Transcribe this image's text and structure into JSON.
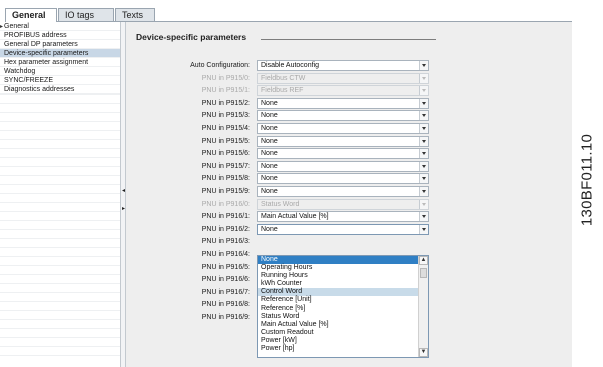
{
  "tabs": [
    "General",
    "IO tags",
    "Texts"
  ],
  "nav": {
    "root": "General",
    "items": [
      "PROFIBUS address",
      "General DP parameters",
      "Device-specific parameters",
      "Hex parameter assignment",
      "Watchdog",
      "SYNC/FREEZE",
      "Diagnostics addresses"
    ],
    "selected_index": 2
  },
  "section_title": "Device-specific parameters",
  "params": [
    {
      "label": "Auto Configuration:",
      "value": "Disable Autoconfig",
      "disabled": false
    },
    {
      "label": "PNU in P915/0:",
      "value": "Fieldbus CTW",
      "disabled": true
    },
    {
      "label": "PNU in P915/1:",
      "value": "Fieldbus REF",
      "disabled": true
    },
    {
      "label": "PNU in P915/2:",
      "value": "None",
      "disabled": false
    },
    {
      "label": "PNU in P915/3:",
      "value": "None",
      "disabled": false
    },
    {
      "label": "PNU in P915/4:",
      "value": "None",
      "disabled": false
    },
    {
      "label": "PNU in P915/5:",
      "value": "None",
      "disabled": false
    },
    {
      "label": "PNU in P915/6:",
      "value": "None",
      "disabled": false
    },
    {
      "label": "PNU in P915/7:",
      "value": "None",
      "disabled": false
    },
    {
      "label": "PNU in P915/8:",
      "value": "None",
      "disabled": false
    },
    {
      "label": "PNU in P915/9:",
      "value": "None",
      "disabled": false
    },
    {
      "label": "PNU in P916/0:",
      "value": "Status Word",
      "disabled": true
    },
    {
      "label": "PNU in P916/1:",
      "value": "Main Actual Value [%]",
      "disabled": false
    },
    {
      "label": "PNU in P916/2:",
      "value": "None",
      "disabled": false,
      "open": true
    },
    {
      "label": "PNU in P916/3:",
      "value": "",
      "disabled": false,
      "covered": true
    },
    {
      "label": "PNU in P916/4:",
      "value": "",
      "disabled": false,
      "covered": true
    },
    {
      "label": "PNU in P916/5:",
      "value": "",
      "disabled": false,
      "covered": true
    },
    {
      "label": "PNU in P916/6:",
      "value": "",
      "disabled": false,
      "covered": true
    },
    {
      "label": "PNU in P916/7:",
      "value": "",
      "disabled": false,
      "covered": true
    },
    {
      "label": "PNU in P916/8:",
      "value": "",
      "disabled": false,
      "covered": true
    },
    {
      "label": "PNU in P916/9:",
      "value": "",
      "disabled": false,
      "covered": true
    }
  ],
  "dropdown_options": [
    "None",
    "Operating Hours",
    "Running Hours",
    "kWh Counter",
    "Control Word",
    "Reference [Unit]",
    "Reference [%]",
    "Status Word",
    "Main Actual Value [%]",
    "Custom Readout",
    "Power [kW]",
    "Power [hp]"
  ],
  "dropdown_first_index": 0,
  "dropdown_highlight_index": 4,
  "doc_code": "130BF011.10",
  "colors": {
    "selected_nav": "#c8d7e6",
    "highlight": "#c8dbe9",
    "dropdown_border": "#7d98b3"
  }
}
